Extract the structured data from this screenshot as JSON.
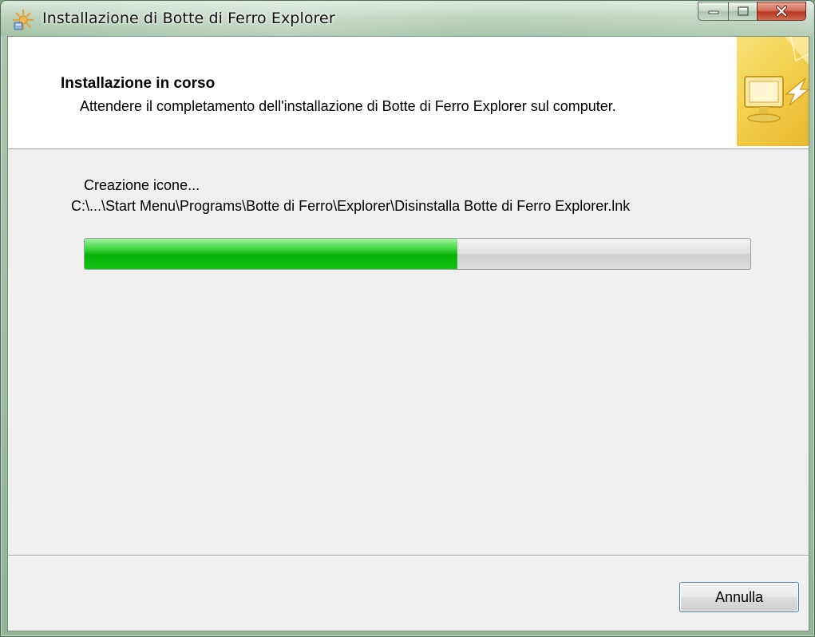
{
  "window": {
    "title": "Installazione di Botte di Ferro Explorer",
    "icon": "installer-icon"
  },
  "caption_buttons": {
    "minimize_icon": "minimize-icon",
    "maximize_icon": "maximize-icon",
    "close_icon": "close-icon"
  },
  "header": {
    "title": "Installazione in corso",
    "subtitle": "Attendere il completamento dell'installazione di Botte di Ferro Explorer sul computer.",
    "image_icon": "install-computer-icon"
  },
  "progress_section": {
    "status": "Creazione icone...",
    "path": "C:\\...\\Start Menu\\Programs\\Botte di Ferro\\Explorer\\Disinstalla Botte di Ferro Explorer.lnk",
    "progress_fraction": 0.56
  },
  "footer": {
    "cancel_label": "Annulla"
  },
  "colors": {
    "progress_green": "#07b007",
    "header_image_accent": "#f3d04e",
    "close_button": "#b8361f",
    "focus_border": "#3c7fb1"
  }
}
